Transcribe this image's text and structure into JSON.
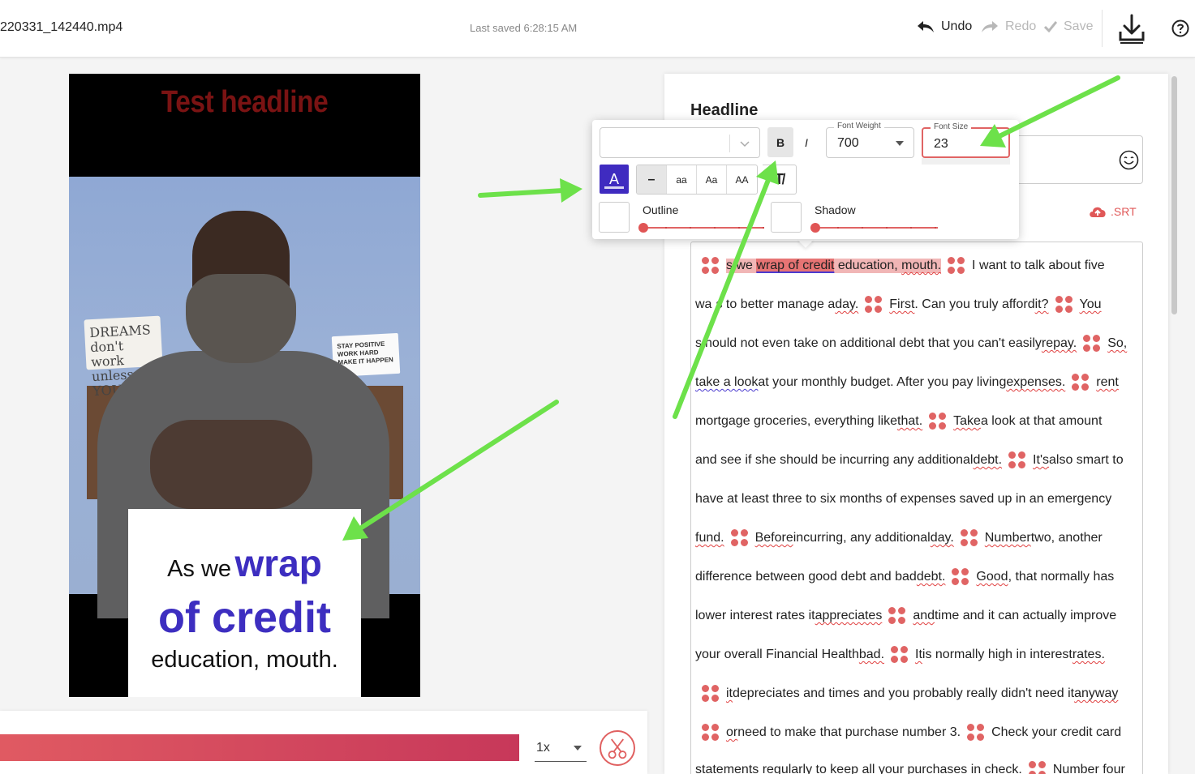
{
  "topbar": {
    "filename": "220331_142440.mp4",
    "last_saved": "Last saved 6:28:15 AM",
    "undo_label": "Undo",
    "redo_label": "Redo",
    "save_label": "Save",
    "download_icon": "download-icon",
    "help_icon": "help-icon"
  },
  "video": {
    "title": "Test headline",
    "caption": {
      "line1_small": "As we",
      "line1_big": "wrap",
      "line2": "of credit",
      "line3": "education, mouth."
    },
    "sign_left": "DREAMS don't work unless YOU DO",
    "sign_right": "STAY POSITIVE WORK HARD MAKE IT HAPPEN"
  },
  "player": {
    "progress": 1.0,
    "speed": "1x",
    "cut_icon": "scissors-icon"
  },
  "panel": {
    "heading": "Headline",
    "srt_label": ".SRT",
    "emoji_icon": "smiley-icon"
  },
  "popup": {
    "font_family": "",
    "bold_label": "B",
    "italic_label": "I",
    "font_weight_label": "Font Weight",
    "font_weight_value": "700",
    "font_size_label": "Font Size",
    "font_size_value": "23",
    "color_label": "A",
    "case_options": [
      "–",
      "aa",
      "Aa",
      "AA"
    ],
    "active_case": "–",
    "clear_format_label": "T̸",
    "outline_label": "Outline",
    "shadow_label": "Shadow",
    "text_color": "#3f2bc0",
    "accent_color": "#e06464"
  },
  "transcript": {
    "l1a": "s we ",
    "l1sel": "wrap of credit",
    "l1b": " education, ",
    "l1c": "mouth.",
    "l1d": "I want to talk about five",
    "l2a": "wa",
    "l2b": "s to better manage a ",
    "l2c": "day.",
    "l2d": "First",
    "l2e": ". Can you truly afford ",
    "l2f": "it?",
    "l2g": "You",
    "l3a": "s",
    "l3b": "hould not even take on additional debt that you can't easily ",
    "l3c": "repay.",
    "l3d": "So,",
    "l4a": "take a look",
    "l4b": " at your monthly budget. After you pay living ",
    "l4c": "expenses.",
    "l4d": "rent",
    "l5a": "mortgage groceries, everything like ",
    "l5b": "that.",
    "l5c": "Take",
    "l5d": " a look at that amount",
    "l6a": "and see if she should be incurring any additional ",
    "l6b": "debt.",
    "l6c": "It's",
    "l6d": " also smart to",
    "l7": "have at least three to six months of expenses saved up in an emergency",
    "l8a": "fund.",
    "l8b": "Before",
    "l8c": " incurring, any additional ",
    "l8d": "day.",
    "l8e": "Number",
    "l8f": " two, another",
    "l9a": "difference between good debt and bad ",
    "l9b": "debt.",
    "l9c": "Good",
    "l9d": ", that normally has",
    "l10a": "lower interest rates it ",
    "l10b": "appreciates",
    "l10c": "and",
    "l10d": " time and it can actually improve",
    "l11a": "your overall Financial Health ",
    "l11b": "bad.",
    "l11c": "It",
    "l11d": " is normally high in interest ",
    "l11e": "rates.",
    "l12a": "it",
    "l12b": " depreciates and times and you probably really didn't need it ",
    "l12c": "anyway",
    "l13a": "or",
    "l13b": " need to make that purchase number 3.",
    "l13c": "Check your credit card",
    "l14a": "statements regularly to keep all your purchases in check.",
    "l14b": "Number four"
  }
}
